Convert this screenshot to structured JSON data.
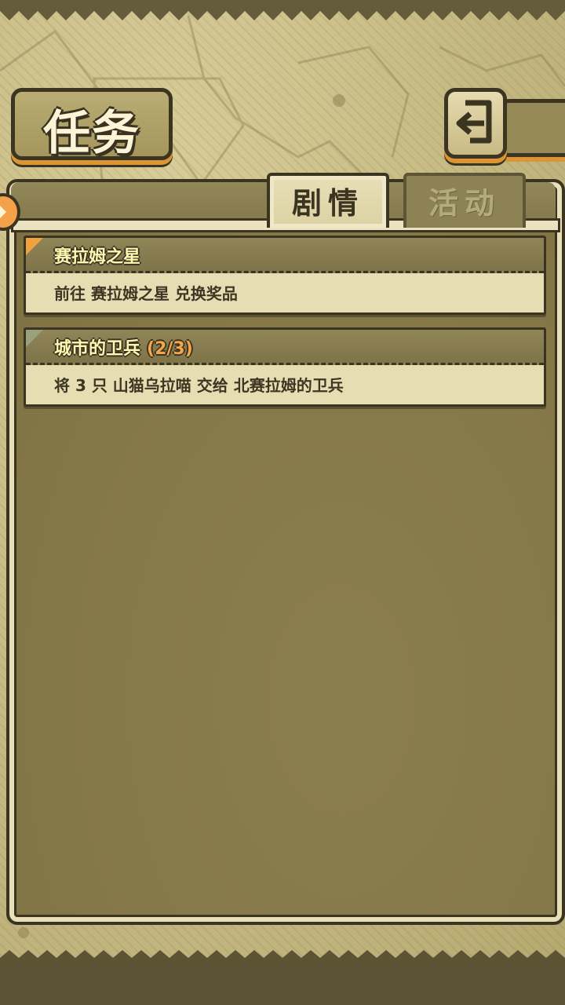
{
  "header": {
    "title": "任务",
    "back_icon": "back-arrow-icon"
  },
  "tabs": [
    {
      "label": "剧情",
      "active": true
    },
    {
      "label": "活动",
      "active": false
    }
  ],
  "quests": [
    {
      "title": "赛拉姆之星",
      "progress": "",
      "description": "前往 赛拉姆之星 兑换奖品",
      "flag_color": "#f0a23e"
    },
    {
      "title": "城市的卫兵",
      "progress": "(2/3)",
      "description": "将 3 只 山猫乌拉喵 交给 北赛拉姆的卫兵",
      "flag_color": "#9aa07c"
    }
  ],
  "colors": {
    "accent": "#f0a23e",
    "outline": "#3b3421",
    "parchment": "#e6ddb3",
    "quest_title": "#fff6b0"
  }
}
